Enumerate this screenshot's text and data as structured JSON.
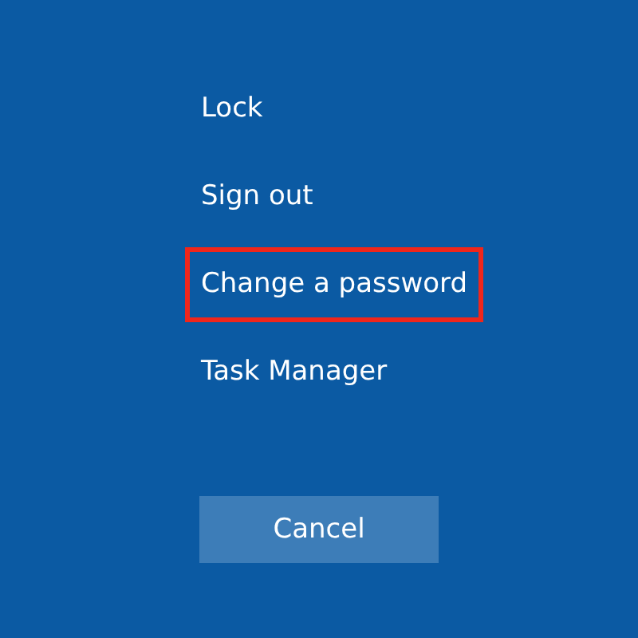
{
  "options": [
    {
      "label": "Lock",
      "highlighted": false
    },
    {
      "label": "Sign out",
      "highlighted": false
    },
    {
      "label": "Change a password",
      "highlighted": true
    },
    {
      "label": "Task Manager",
      "highlighted": false
    }
  ],
  "cancel_button": {
    "label": "Cancel"
  }
}
